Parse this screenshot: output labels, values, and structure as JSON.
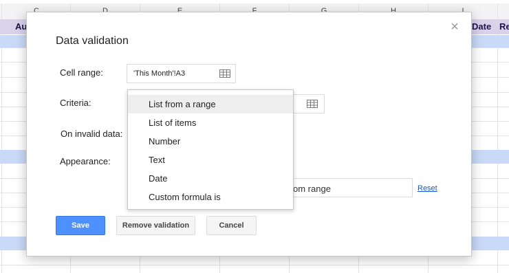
{
  "sheet": {
    "columns": [
      "C",
      "D",
      "E",
      "F",
      "G",
      "H",
      "I"
    ],
    "header_cells": {
      "left": "Au",
      "right1": "Date",
      "right2": "Re"
    },
    "colors": {
      "band": "#c9daf8",
      "header_row": "#d9d2e9"
    }
  },
  "dialog": {
    "title": "Data validation",
    "close_glyph": "×",
    "cell_range": {
      "label": "Cell range:",
      "value": "'This Month'!A3"
    },
    "criteria": {
      "label": "Criteria:",
      "range_placeholder": "",
      "options": [
        "List from a range",
        "List of items",
        "Number",
        "Text",
        "Date",
        "Custom formula is"
      ],
      "highlighted": "List from a range"
    },
    "on_invalid": {
      "label": "On invalid data:"
    },
    "appearance": {
      "label": "Appearance:",
      "help_text_partial": "om range",
      "reset": "Reset"
    },
    "buttons": {
      "save": "Save",
      "remove": "Remove validation",
      "cancel": "Cancel"
    },
    "colors": {
      "primary": "#4d90fe",
      "link": "#1155cc"
    }
  }
}
